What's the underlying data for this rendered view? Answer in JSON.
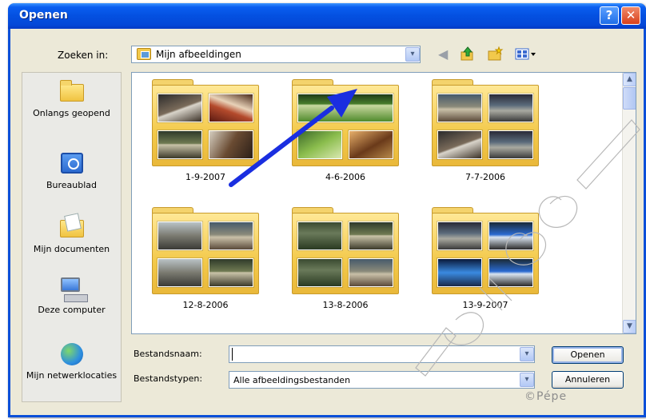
{
  "window": {
    "title": "Openen",
    "help_label": "?",
    "close_label": "✕"
  },
  "toolbar": {
    "look_in_label": "Zoeken in:",
    "look_in_value": "Mijn afbeeldingen",
    "dropdown_glyph": "▾",
    "icons": [
      "back-icon",
      "up-folder-icon",
      "new-folder-icon",
      "view-menu-icon"
    ]
  },
  "places": [
    {
      "label": "Onlangs geopend",
      "icon": "recent-folder-icon"
    },
    {
      "label": "Bureaublad",
      "icon": "desktop-icon"
    },
    {
      "label": "Mijn documenten",
      "icon": "documents-icon"
    },
    {
      "label": "Deze computer",
      "icon": "computer-icon"
    },
    {
      "label": "Mijn netwerklocaties",
      "icon": "network-icon"
    }
  ],
  "folders": [
    "1-9-2007",
    "4-6-2006",
    "7-7-2006",
    "12-8-2006",
    "13-8-2006",
    "13-9-2007"
  ],
  "form": {
    "filename_label": "Bestandsnaam:",
    "filename_value": "",
    "filetype_label": "Bestandstypen:",
    "filetype_value": "Alle afbeeldingsbestanden",
    "open_button": "Openen",
    "cancel_button": "Annuleren"
  },
  "watermark": "©Pépe",
  "colors": {
    "titlebar": "#0450e0",
    "annotation_arrow": "#1a2ee0",
    "close_button": "#d8401c"
  }
}
